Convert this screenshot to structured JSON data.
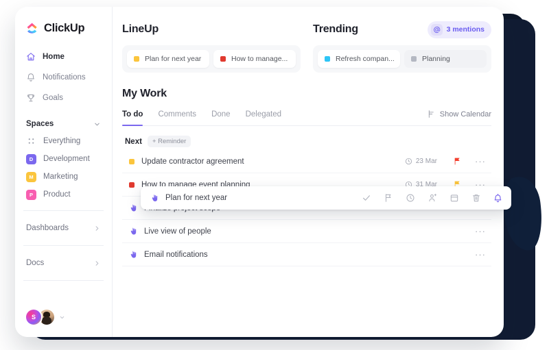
{
  "brand": {
    "name": "ClickUp",
    "logo_icon": "clickup-logo-icon"
  },
  "sidebar": {
    "nav": [
      {
        "label": "Home",
        "icon": "home-icon",
        "active": true
      },
      {
        "label": "Notifications",
        "icon": "bell-icon",
        "active": false
      },
      {
        "label": "Goals",
        "icon": "trophy-icon",
        "active": false
      }
    ],
    "spaces_section": {
      "label": "Spaces",
      "chevron": "chevron-down-icon"
    },
    "spaces": [
      {
        "label": "Everything",
        "badge": "",
        "color": "#9ca0ac",
        "icon": "grid-dots-icon"
      },
      {
        "label": "Development",
        "badge": "D",
        "color": "#7b68ee"
      },
      {
        "label": "Marketing",
        "badge": "M",
        "color": "#fbc53d"
      },
      {
        "label": "Product",
        "badge": "P",
        "color": "#f85eb0"
      }
    ],
    "footer_items": [
      {
        "label": "Dashboards",
        "chevron": "chevron-right-icon"
      },
      {
        "label": "Docs",
        "chevron": "chevron-right-icon"
      }
    ],
    "user": {
      "initial": "S",
      "caret": "chevron-down-icon"
    }
  },
  "lineup": {
    "title": "LineUp",
    "chips": [
      {
        "label": "Plan for next year",
        "color": "#fbc53d",
        "muted": false
      },
      {
        "label": "How to manage...",
        "color": "#e03a2f",
        "muted": false
      }
    ]
  },
  "trending": {
    "title": "Trending",
    "mentions": {
      "count_label": "3 mentions",
      "icon": "at-mention-icon",
      "accent": "#6a5cf0"
    },
    "chips": [
      {
        "label": "Refresh compan...",
        "color": "#2ec5f6",
        "muted": false
      },
      {
        "label": "Planning",
        "color": "#b4b8c2",
        "muted": true
      }
    ]
  },
  "my_work": {
    "title": "My Work",
    "tabs": [
      {
        "label": "To do",
        "active": true
      },
      {
        "label": "Comments",
        "active": false
      },
      {
        "label": "Done",
        "active": false
      },
      {
        "label": "Delegated",
        "active": false
      }
    ],
    "calendar_button": {
      "label": "Show Calendar",
      "icon": "calendar-toggle-icon"
    },
    "group": {
      "label": "Next",
      "reminder_button": "+ Reminder"
    },
    "tasks": [
      {
        "name": "Update contractor agreement",
        "dot_color": "#fbc53d",
        "icon": "color-dot",
        "due": "23 Mar",
        "due_icon": "clock-icon",
        "flag_color": "#f3402f",
        "menu": "···"
      },
      {
        "name": "How to manage event planning",
        "dot_color": "#e03a2f",
        "icon": "color-dot",
        "due": "31 Mar",
        "due_icon": "clock-icon",
        "flag_color": "#fbc53d",
        "menu": "···"
      },
      {
        "name": "Finalize project scope",
        "dot_color": "#7b68ee",
        "icon": "pointer-hand-icon",
        "due": "",
        "due_icon": "",
        "flag_color": "",
        "menu": "···"
      },
      {
        "name": "Live view of people",
        "dot_color": "#7b68ee",
        "icon": "pointer-hand-icon",
        "due": "",
        "due_icon": "",
        "flag_color": "",
        "menu": "···"
      },
      {
        "name": "Email notifications",
        "dot_color": "#7b68ee",
        "icon": "pointer-hand-icon",
        "due": "",
        "due_icon": "",
        "flag_color": "",
        "menu": "···"
      }
    ]
  },
  "floating_card": {
    "name": "Plan for next year",
    "icon": "pointer-hand-icon",
    "actions": [
      {
        "name": "check-icon",
        "active": false
      },
      {
        "name": "flag-icon",
        "active": false
      },
      {
        "name": "clock-icon",
        "active": false
      },
      {
        "name": "person-add-icon",
        "active": false
      },
      {
        "name": "calendar-icon",
        "active": false
      },
      {
        "name": "trash-icon",
        "active": false
      },
      {
        "name": "bell-icon",
        "active": true
      }
    ],
    "active_color": "#7b68ee"
  }
}
